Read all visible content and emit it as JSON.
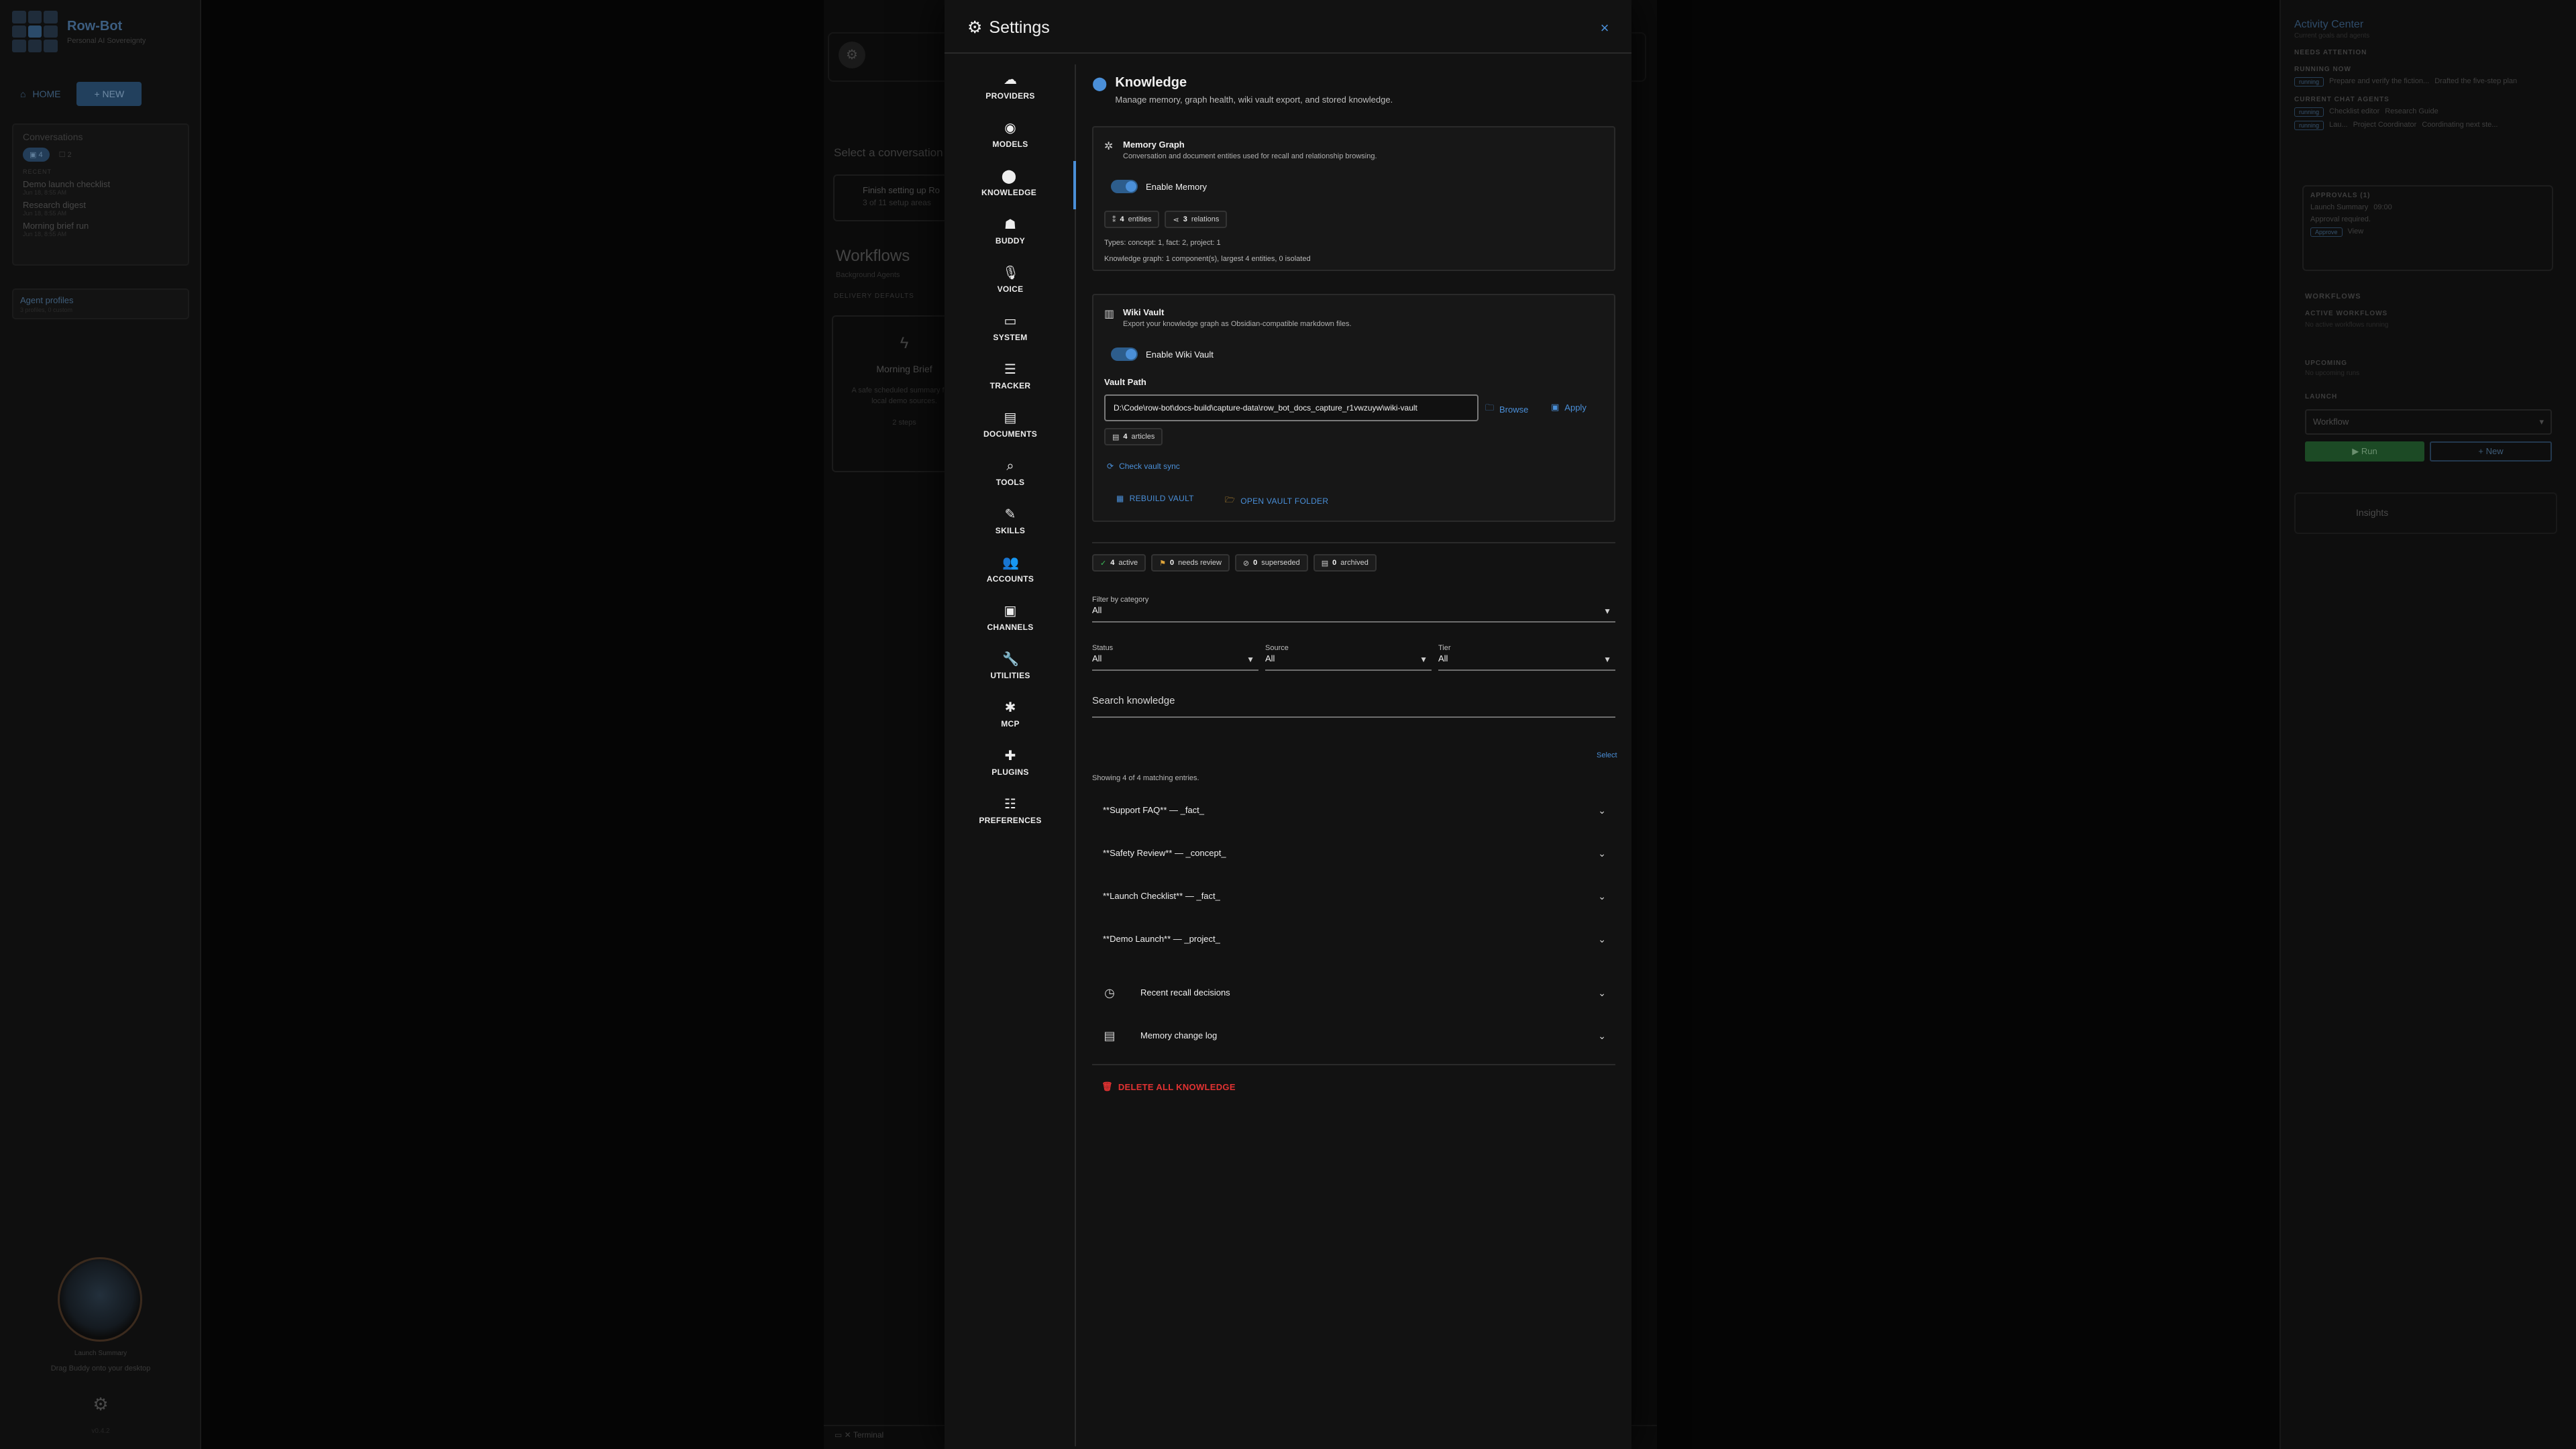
{
  "app": {
    "brand_name": "Row-Bot",
    "brand_sub": "Personal AI Sovereignty",
    "nav_home": "HOME",
    "nav_new": "+ NEW",
    "conversations_title": "Conversations",
    "conv_chip_count": "4",
    "conv_msg_count": "2",
    "recent_label": "RECENT",
    "recent_items": [
      {
        "title": "Demo launch checklist",
        "date": "Jun 18, 8:55 AM"
      },
      {
        "title": "Research digest",
        "date": "Jun 18, 8:55 AM"
      },
      {
        "title": "Morning brief run",
        "date": "Jun 18, 8:55 AM"
      }
    ],
    "agent_profiles": "Agent profiles",
    "agent_profiles_sub": "3 profiles, 0 custom",
    "buddy_label": "Launch Summary",
    "buddy_hint": "Drag Buddy onto your desktop",
    "version": "v0.4.2"
  },
  "center": {
    "select_conversation": "Select a conversation",
    "setup_title": "Finish setting up Ro",
    "setup_sub": "3 of 11 setup areas",
    "workflows_title": "Workflows",
    "workflows_sub": "Background Agents",
    "delivery_defaults": "DELIVERY DEFAULTS",
    "card_title": "Morning Brief",
    "card_desc": "A safe scheduled summary from local demo sources.",
    "card_steps": "2 steps",
    "terminal": "Terminal"
  },
  "right": {
    "activity_title": "Activity Center",
    "activity_sub": "Current goals and agents",
    "needs_attention": "NEEDS ATTENTION",
    "running_now": "RUNNING NOW",
    "running_tag": "running",
    "running_text": "Prepare and verify the fiction...",
    "running_extra": "Drafted the five-step plan",
    "current_agents": "CURRENT CHAT AGENTS",
    "agent1_tag": "running",
    "agent1": "Checklist editor",
    "agent1_role": "Research Guide",
    "agent2_tag": "running",
    "agent2": "Lau...",
    "agent2_role": "Project Coordinator",
    "agent2_extra": "Coordinating next ste...",
    "approvals": "APPROVALS (1)",
    "approval_title": "Launch Summary",
    "approval_time": "09:00",
    "approval_desc": "Approval required.",
    "approve_label": "Approve",
    "view_label": "View",
    "workflows": "WORKFLOWS",
    "active_workflows": "ACTIVE WORKFLOWS",
    "no_active": "No active workflows running",
    "upcoming": "UPCOMING",
    "no_upcoming": "No upcoming runs",
    "launch": "LAUNCH",
    "workflow_select": "Workflow",
    "run": "Run",
    "new": "New",
    "insights": "Insights"
  },
  "dialog": {
    "title": "Settings",
    "close_glyph": "×",
    "nav": [
      {
        "key": "providers",
        "label": "PROVIDERS",
        "icon": "☁"
      },
      {
        "key": "models",
        "label": "MODELS",
        "icon": "◉"
      },
      {
        "key": "knowledge",
        "label": "KNOWLEDGE",
        "icon": "⬤"
      },
      {
        "key": "buddy",
        "label": "BUDDY",
        "icon": "☗"
      },
      {
        "key": "voice",
        "label": "VOICE",
        "icon": "🎙"
      },
      {
        "key": "system",
        "label": "SYSTEM",
        "icon": "▭"
      },
      {
        "key": "tracker",
        "label": "TRACKER",
        "icon": "☰"
      },
      {
        "key": "documents",
        "label": "DOCUMENTS",
        "icon": "▤"
      },
      {
        "key": "tools",
        "label": "TOOLS",
        "icon": "⌕"
      },
      {
        "key": "skills",
        "label": "SKILLS",
        "icon": "✎"
      },
      {
        "key": "accounts",
        "label": "ACCOUNTS",
        "icon": "👥"
      },
      {
        "key": "channels",
        "label": "CHANNELS",
        "icon": "▣"
      },
      {
        "key": "utilities",
        "label": "UTILITIES",
        "icon": "🔧"
      },
      {
        "key": "mcp",
        "label": "MCP",
        "icon": "✱"
      },
      {
        "key": "plugins",
        "label": "PLUGINS",
        "icon": "✚"
      },
      {
        "key": "preferences",
        "label": "PREFERENCES",
        "icon": "☷"
      }
    ],
    "active_nav": "knowledge"
  },
  "knowledge": {
    "title": "Knowledge",
    "description": "Manage memory, graph health, wiki vault export, and stored knowledge.",
    "memory": {
      "title": "Memory Graph",
      "description": "Conversation and document entities used for recall and relationship browsing.",
      "toggle_label": "Enable Memory",
      "enabled": true,
      "entities_count": "4",
      "entities_label": "entities",
      "relations_count": "3",
      "relations_label": "relations",
      "types_text": "Types: concept: 1, fact: 2, project: 1",
      "graph_text": "Knowledge graph: 1 component(s), largest 4 entities, 0 isolated"
    },
    "vault": {
      "title": "Wiki Vault",
      "description": "Export your knowledge graph as Obsidian-compatible markdown files.",
      "toggle_label": "Enable Wiki Vault",
      "enabled": true,
      "path_label": "Vault Path",
      "path_value": "D:\\Code\\row-bot\\docs-build\\capture-data\\row_bot_docs_capture_r1vwzuyw\\wiki-vault",
      "browse": "Browse",
      "apply": "Apply",
      "articles_count": "4",
      "articles_label": "articles",
      "check_sync": "Check vault sync",
      "rebuild": "REBUILD VAULT",
      "open_folder": "OPEN VAULT FOLDER"
    },
    "status_chips": [
      {
        "count": "4",
        "label": "active",
        "color": "#3cbf5a",
        "icon": "✓"
      },
      {
        "count": "0",
        "label": "needs review",
        "color": "#e0a53a",
        "icon": "⚑"
      },
      {
        "count": "0",
        "label": "superseded",
        "color": "#bdbdbd",
        "icon": "⊘"
      },
      {
        "count": "0",
        "label": "archived",
        "color": "#bdbdbd",
        "icon": "▤"
      }
    ],
    "filter_category": {
      "label": "Filter by category",
      "value": "All"
    },
    "status_filter": {
      "label": "Status",
      "value": "All"
    },
    "source_filter": {
      "label": "Source",
      "value": "All"
    },
    "tier_filter": {
      "label": "Tier",
      "value": "All"
    },
    "search_placeholder": "Search knowledge",
    "select_link": "Select",
    "showing_text": "Showing 4 of 4 matching entries.",
    "entries": [
      "**Support FAQ** — _fact_",
      "**Safety Review** — _concept_",
      "**Launch Checklist** — _fact_",
      "**Demo Launch** — _project_"
    ],
    "recent_recall": "Recent recall decisions",
    "change_log": "Memory change log",
    "delete_all": "DELETE ALL KNOWLEDGE"
  }
}
